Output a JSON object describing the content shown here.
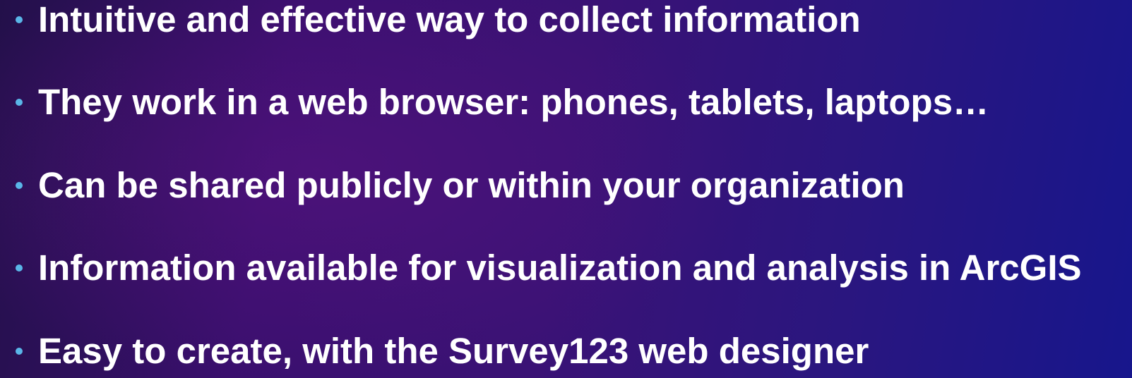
{
  "slide": {
    "bullets": [
      {
        "text": "Intuitive and effective way to collect information"
      },
      {
        "text": "They work in a web browser: phones, tablets, laptops…"
      },
      {
        "text": "Can be shared publicly or within your organization"
      },
      {
        "text": "Information available for visualization and analysis in ArcGIS"
      },
      {
        "text": "Easy to create, with the Survey123 web designer"
      }
    ]
  },
  "colors": {
    "text": "#ffffff",
    "bullet": "#5ab6e8",
    "background_left": "#23104a",
    "background_right": "#17168c"
  }
}
